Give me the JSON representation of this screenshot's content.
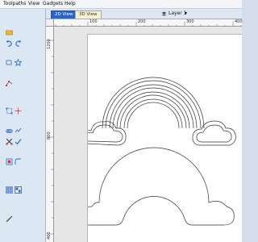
{
  "menubar": {
    "items": [
      "Toolpaths",
      "View",
      "Gadgets",
      "Help"
    ]
  },
  "tabs": [
    {
      "label": "2D View",
      "active": true
    },
    {
      "label": "3D View",
      "active": false
    }
  ],
  "layer": {
    "label": "Layer 1",
    "arrow": "▾"
  },
  "rulers": {
    "top": [
      "100",
      "200",
      "300",
      "400"
    ],
    "left": [
      "1200",
      "800",
      "400"
    ]
  },
  "colors": {
    "toolbar_bg": "#dce7f4",
    "tab_active": "#2a63c9",
    "outline": "#333333"
  }
}
